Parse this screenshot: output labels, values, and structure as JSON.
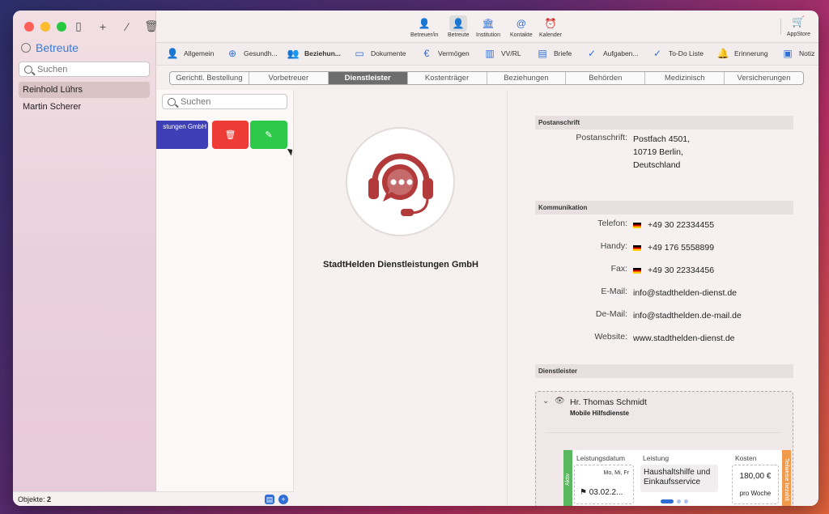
{
  "sidebar": {
    "title": "Betreute",
    "search_placeholder": "Suchen",
    "items": [
      {
        "label": "Reinhold Lührs",
        "selected": true
      },
      {
        "label": "Martin Scherer",
        "selected": false
      }
    ],
    "footer_label": "Objekte:",
    "footer_count": "2"
  },
  "toolbar": {
    "buttons": [
      {
        "label": "Betreuer/in",
        "icon": "person-tie-icon"
      },
      {
        "label": "Betreute",
        "icon": "person-icon"
      },
      {
        "label": "Institution",
        "icon": "bank-icon"
      },
      {
        "label": "Kontakte",
        "icon": "at-icon"
      },
      {
        "label": "Kalender",
        "icon": "alarm-icon"
      }
    ],
    "appstore_label": "AppStore"
  },
  "subnav": [
    {
      "label": "Allgemein"
    },
    {
      "label": "Gesundh..."
    },
    {
      "label": "Beziehun..."
    },
    {
      "label": "Dokumente"
    },
    {
      "label": "Vermögen"
    },
    {
      "label": "VV/RL"
    },
    {
      "label": "Briefe"
    },
    {
      "label": "Aufgaben..."
    },
    {
      "label": "To-Do Liste"
    },
    {
      "label": "Erinnerung"
    },
    {
      "label": "Notiz"
    }
  ],
  "segments": [
    "Gerichtl. Bestellung",
    "Vorbetreuer",
    "Dienstleister",
    "Kostenträger",
    "Beziehungen",
    "Behörden",
    "Medizinisch",
    "Versicherungen"
  ],
  "list": {
    "search_placeholder": "Suchen",
    "card_text": "stungen GmbH"
  },
  "detail": {
    "company_name": "StadtHelden Dienstleistungen GmbH"
  },
  "right": {
    "postanschrift_head": "Postanschrift",
    "postanschrift_label": "Postanschrift:",
    "postanschrift_lines": [
      "Postfach 4501,",
      "10719 Berlin,",
      "Deutschland"
    ],
    "kommunikation_head": "Kommunikation",
    "telefon_label": "Telefon:",
    "telefon": "+49 30 22334455",
    "handy_label": "Handy:",
    "handy": "+49 176 5558899",
    "fax_label": "Fax:",
    "fax": "+49 30 22334456",
    "email_label": "E-Mail:",
    "email": "info@stadthelden-dienst.de",
    "demail_label": "De-Mail:",
    "demail": "info@stadthelden.de-mail.de",
    "website_label": "Website:",
    "website": "www.stadthelden-dienst.de",
    "dienstleister_head": "Dienstleister",
    "dl_name": "Hr. Thomas Schmidt",
    "dl_sub": "Mobile Hilfsdienste",
    "entry": {
      "status_left": "Aktiv",
      "status_right": "Teilweise bezahlt",
      "h_datum": "Leistungsdatum",
      "h_leistung": "Leistung",
      "h_kosten": "Kosten",
      "days": "Mo, Mi, Fr",
      "date": "03.02.2...",
      "leistung": "Haushaltshilfe und Einkaufsservice",
      "cost": "180,00 €",
      "per": "pro Woche"
    }
  },
  "colors": {
    "accent": "#2e6fd6",
    "delete": "#ef3b36",
    "edit": "#2ec94a",
    "card": "#3e3fb6",
    "logo": "#b23a3a"
  }
}
